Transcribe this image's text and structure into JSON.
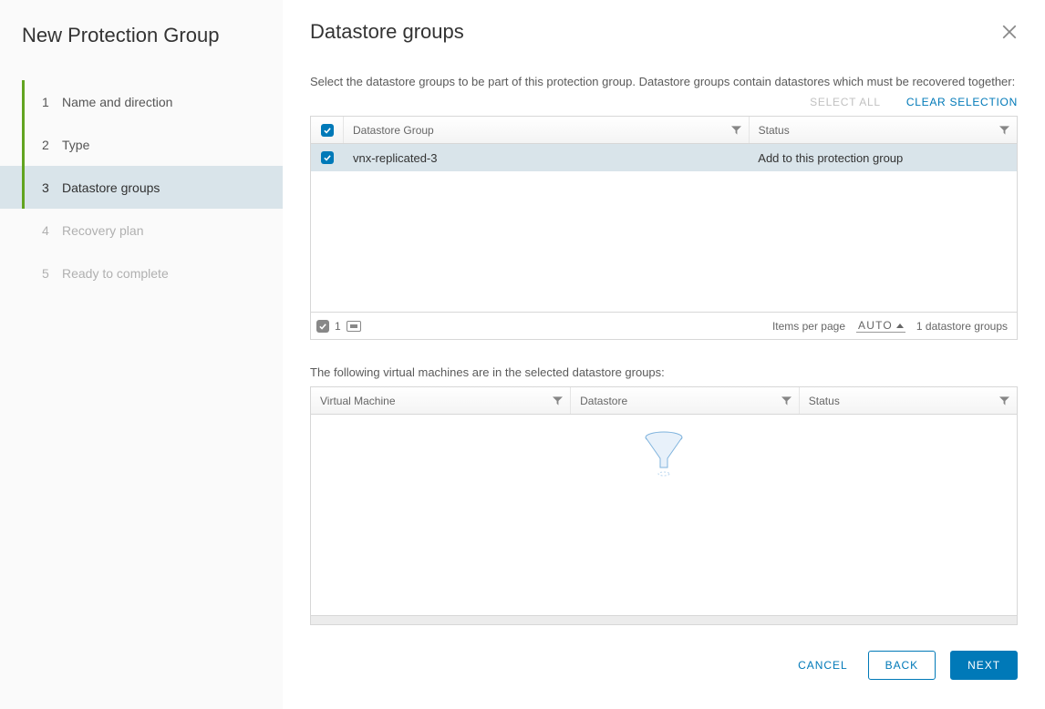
{
  "sidebar": {
    "title": "New Protection Group",
    "steps": [
      {
        "num": "1",
        "label": "Name and direction"
      },
      {
        "num": "2",
        "label": "Type"
      },
      {
        "num": "3",
        "label": "Datastore groups"
      },
      {
        "num": "4",
        "label": "Recovery plan"
      },
      {
        "num": "5",
        "label": "Ready to complete"
      }
    ]
  },
  "main": {
    "title": "Datastore groups",
    "description": "Select the datastore groups to be part of this protection group. Datastore groups contain datastores which must be recovered together:",
    "select_all": "SELECT ALL",
    "clear_selection": "CLEAR SELECTION",
    "table1": {
      "headers": {
        "group": "Datastore Group",
        "status": "Status"
      },
      "rows": [
        {
          "name": "vnx-replicated-3",
          "status": "Add to this protection group"
        }
      ],
      "footer": {
        "count": "1",
        "per_page_label": "Items per page",
        "per_page_value": "AUTO",
        "total": "1 datastore groups"
      }
    },
    "vm_desc": "The following virtual machines are in the selected datastore groups:",
    "table2": {
      "headers": {
        "vm": "Virtual Machine",
        "ds": "Datastore",
        "status": "Status"
      }
    }
  },
  "buttons": {
    "cancel": "CANCEL",
    "back": "BACK",
    "next": "NEXT"
  }
}
